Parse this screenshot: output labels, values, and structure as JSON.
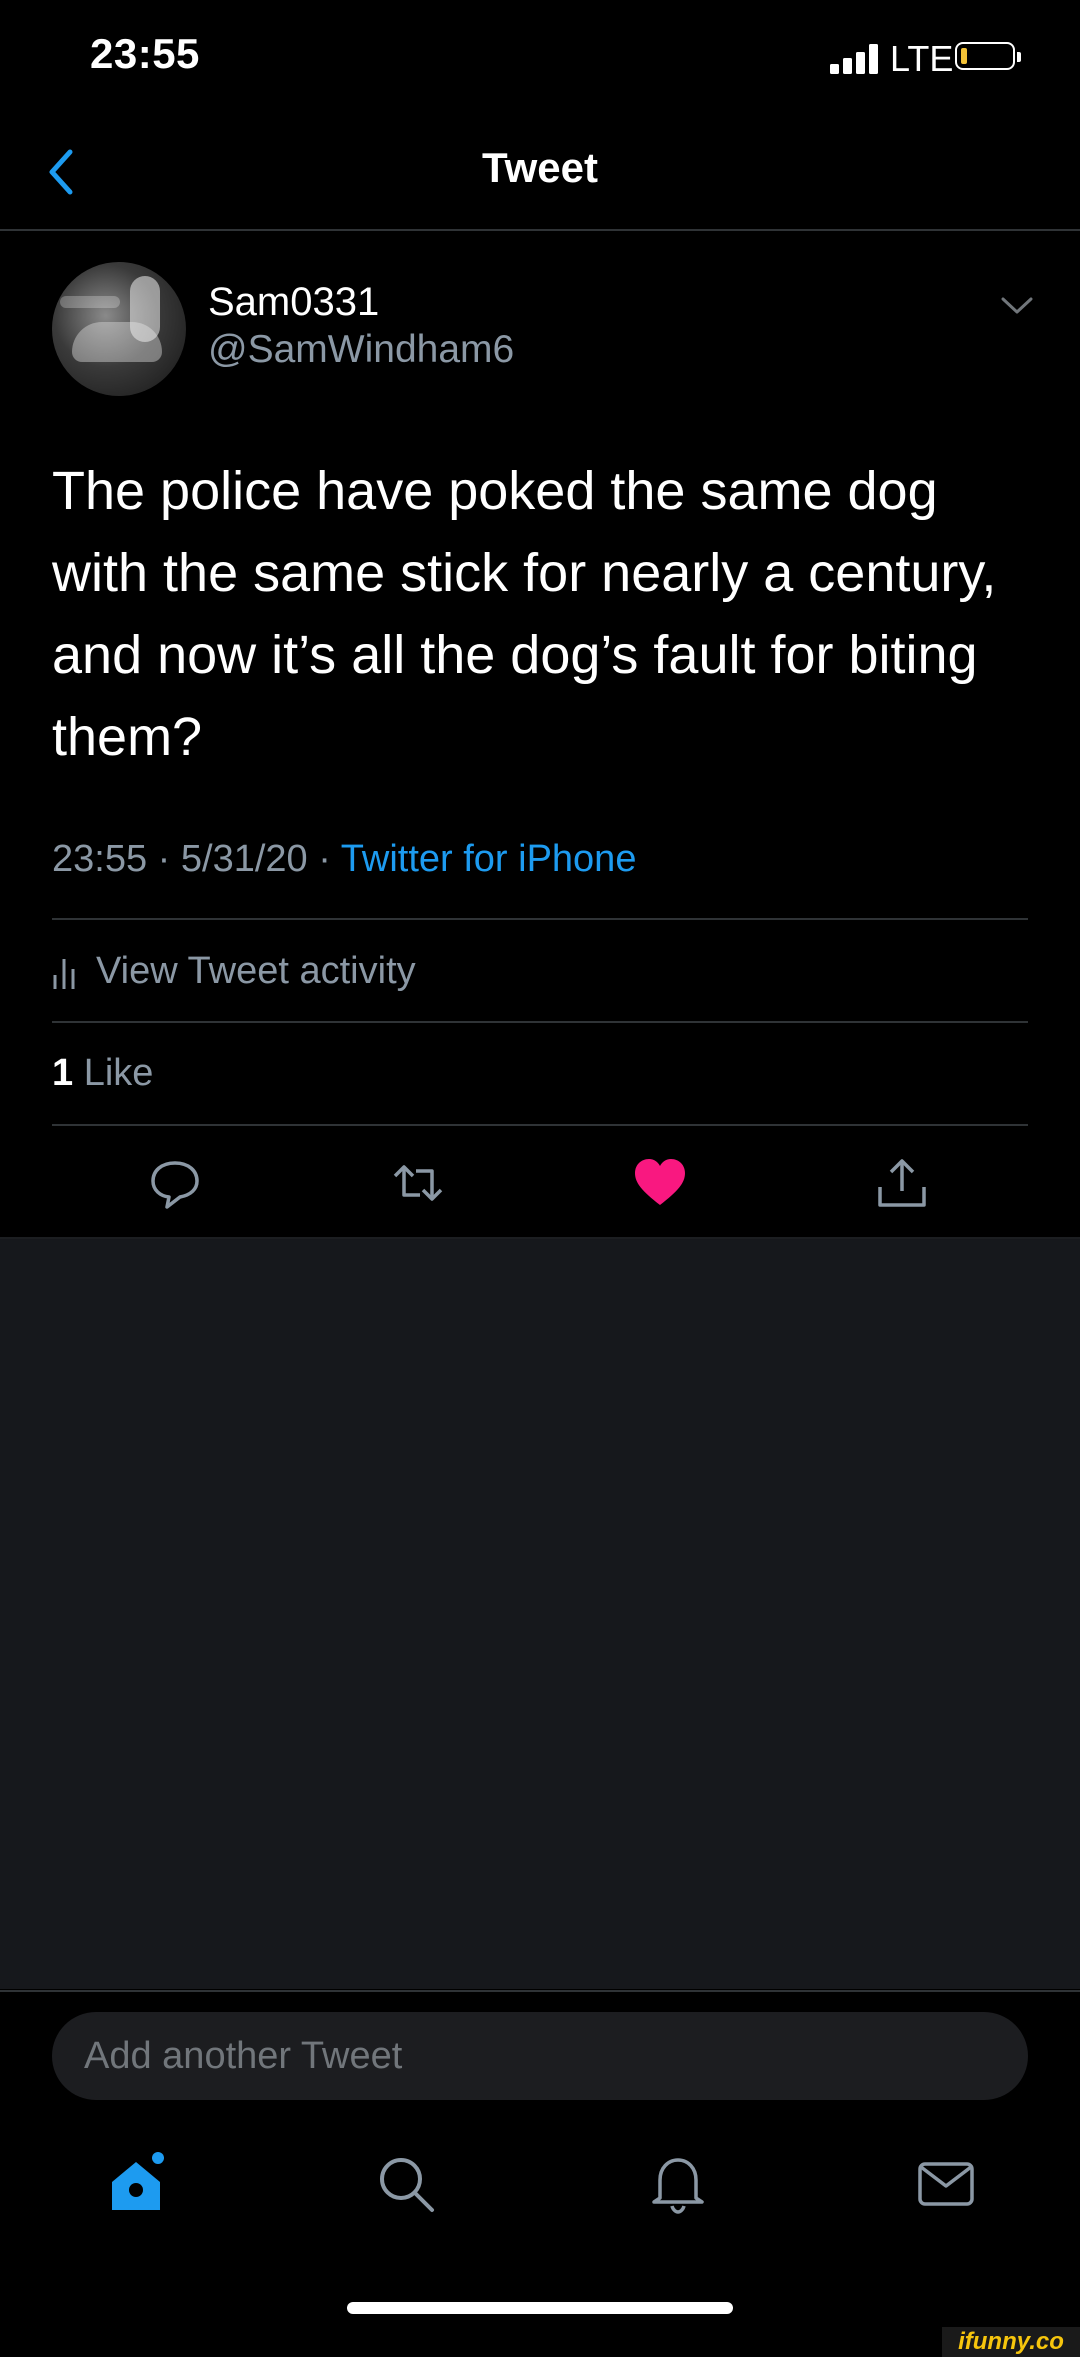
{
  "status_bar": {
    "time": "23:55",
    "network": "LTE"
  },
  "nav": {
    "title": "Tweet"
  },
  "tweet": {
    "display_name": "Sam0331",
    "handle": "@SamWindham6",
    "text": "The police have poked the same dog with the same stick for nearly a century, and now it’s all the dog’s fault for biting them?",
    "time": "23:55",
    "separator": "·",
    "date": "5/31/20",
    "source": "Twitter for iPhone",
    "activity_label": "View Tweet activity",
    "like_count": "1",
    "like_label": "Like",
    "liked": true
  },
  "actions": [
    {
      "icon": "reply-icon"
    },
    {
      "icon": "retweet-icon"
    },
    {
      "icon": "heart-icon",
      "color": "#f91880"
    },
    {
      "icon": "share-icon"
    }
  ],
  "compose": {
    "placeholder": "Add another Tweet"
  },
  "tab_bar": [
    {
      "icon": "home-icon",
      "active": true,
      "color": "#1d9bf0"
    },
    {
      "icon": "search-icon"
    },
    {
      "icon": "notifications-icon"
    },
    {
      "icon": "messages-icon"
    }
  ],
  "watermark": "ifunny.co",
  "colors": {
    "accent": "#1d9bf0",
    "like": "#f91880",
    "secondary_text": "#8b98a5",
    "background": "#000000"
  }
}
